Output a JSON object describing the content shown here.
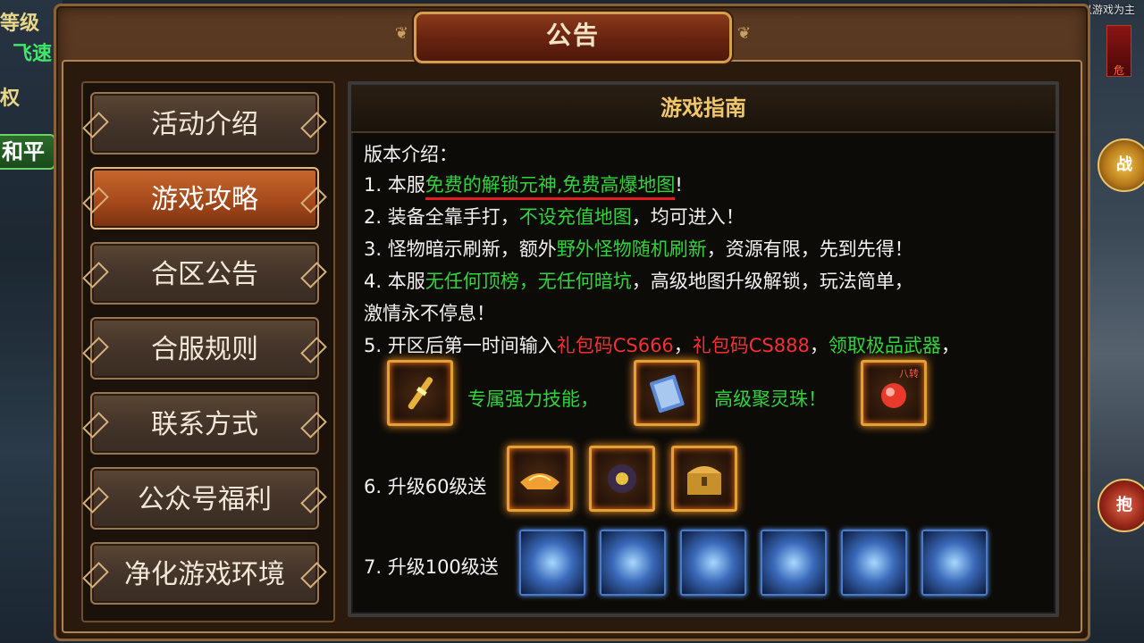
{
  "hud": {
    "level_label": "等级",
    "fly_label": "飞速",
    "right_label": "权",
    "peace_label": "和平",
    "disclaimer": "本广告仅供参考，实际以游戏为主",
    "side_btn_1": "战",
    "side_btn_2": "抱",
    "tag": "危"
  },
  "panel": {
    "title": "公告"
  },
  "menu": {
    "items": [
      {
        "label": "活动介绍"
      },
      {
        "label": "游戏攻略",
        "active": true
      },
      {
        "label": "合区公告"
      },
      {
        "label": "合服规则"
      },
      {
        "label": "联系方式"
      },
      {
        "label": "公众号福利"
      },
      {
        "label": "净化游戏环境"
      }
    ]
  },
  "guide": {
    "header": "游戏指南",
    "intro": "版本介绍：",
    "l1": {
      "a": "1. 本服",
      "b": "免费的解锁元神,免费高爆地图",
      "c": "!"
    },
    "l2": {
      "a": "2. 装备全靠手打，",
      "b": "不设充值地图",
      "c": "，均可进入！"
    },
    "l3": {
      "a": "3. 怪物暗示刷新，额外",
      "b": "野外怪物随机刷新",
      "c": "，资源有限，先到先得！"
    },
    "l4": {
      "a": "4. 本服",
      "b": "无任何顶榜，无任何暗坑",
      "c": "，高级地图升级解锁，玩法简单，"
    },
    "l4b": "激情永不停息！",
    "l5": {
      "a": "5. 开区后第一时间输入",
      "b": "礼包码CS666",
      "c": "，",
      "d": "礼包码CS888",
      "e": "，",
      "f": "领取极品武器",
      "g": "，"
    },
    "reward_1": "专属强力技能，",
    "reward_2": "高级聚灵珠！",
    "l6": "6. 升级60级送",
    "l7": "7. 升级100级送",
    "icon_badge": "八转"
  },
  "colors": {
    "green_highlight": "#2fd43a",
    "red_highlight": "#f43030",
    "gold_header": "#f0c66a",
    "active_tab": "#c8682e"
  }
}
